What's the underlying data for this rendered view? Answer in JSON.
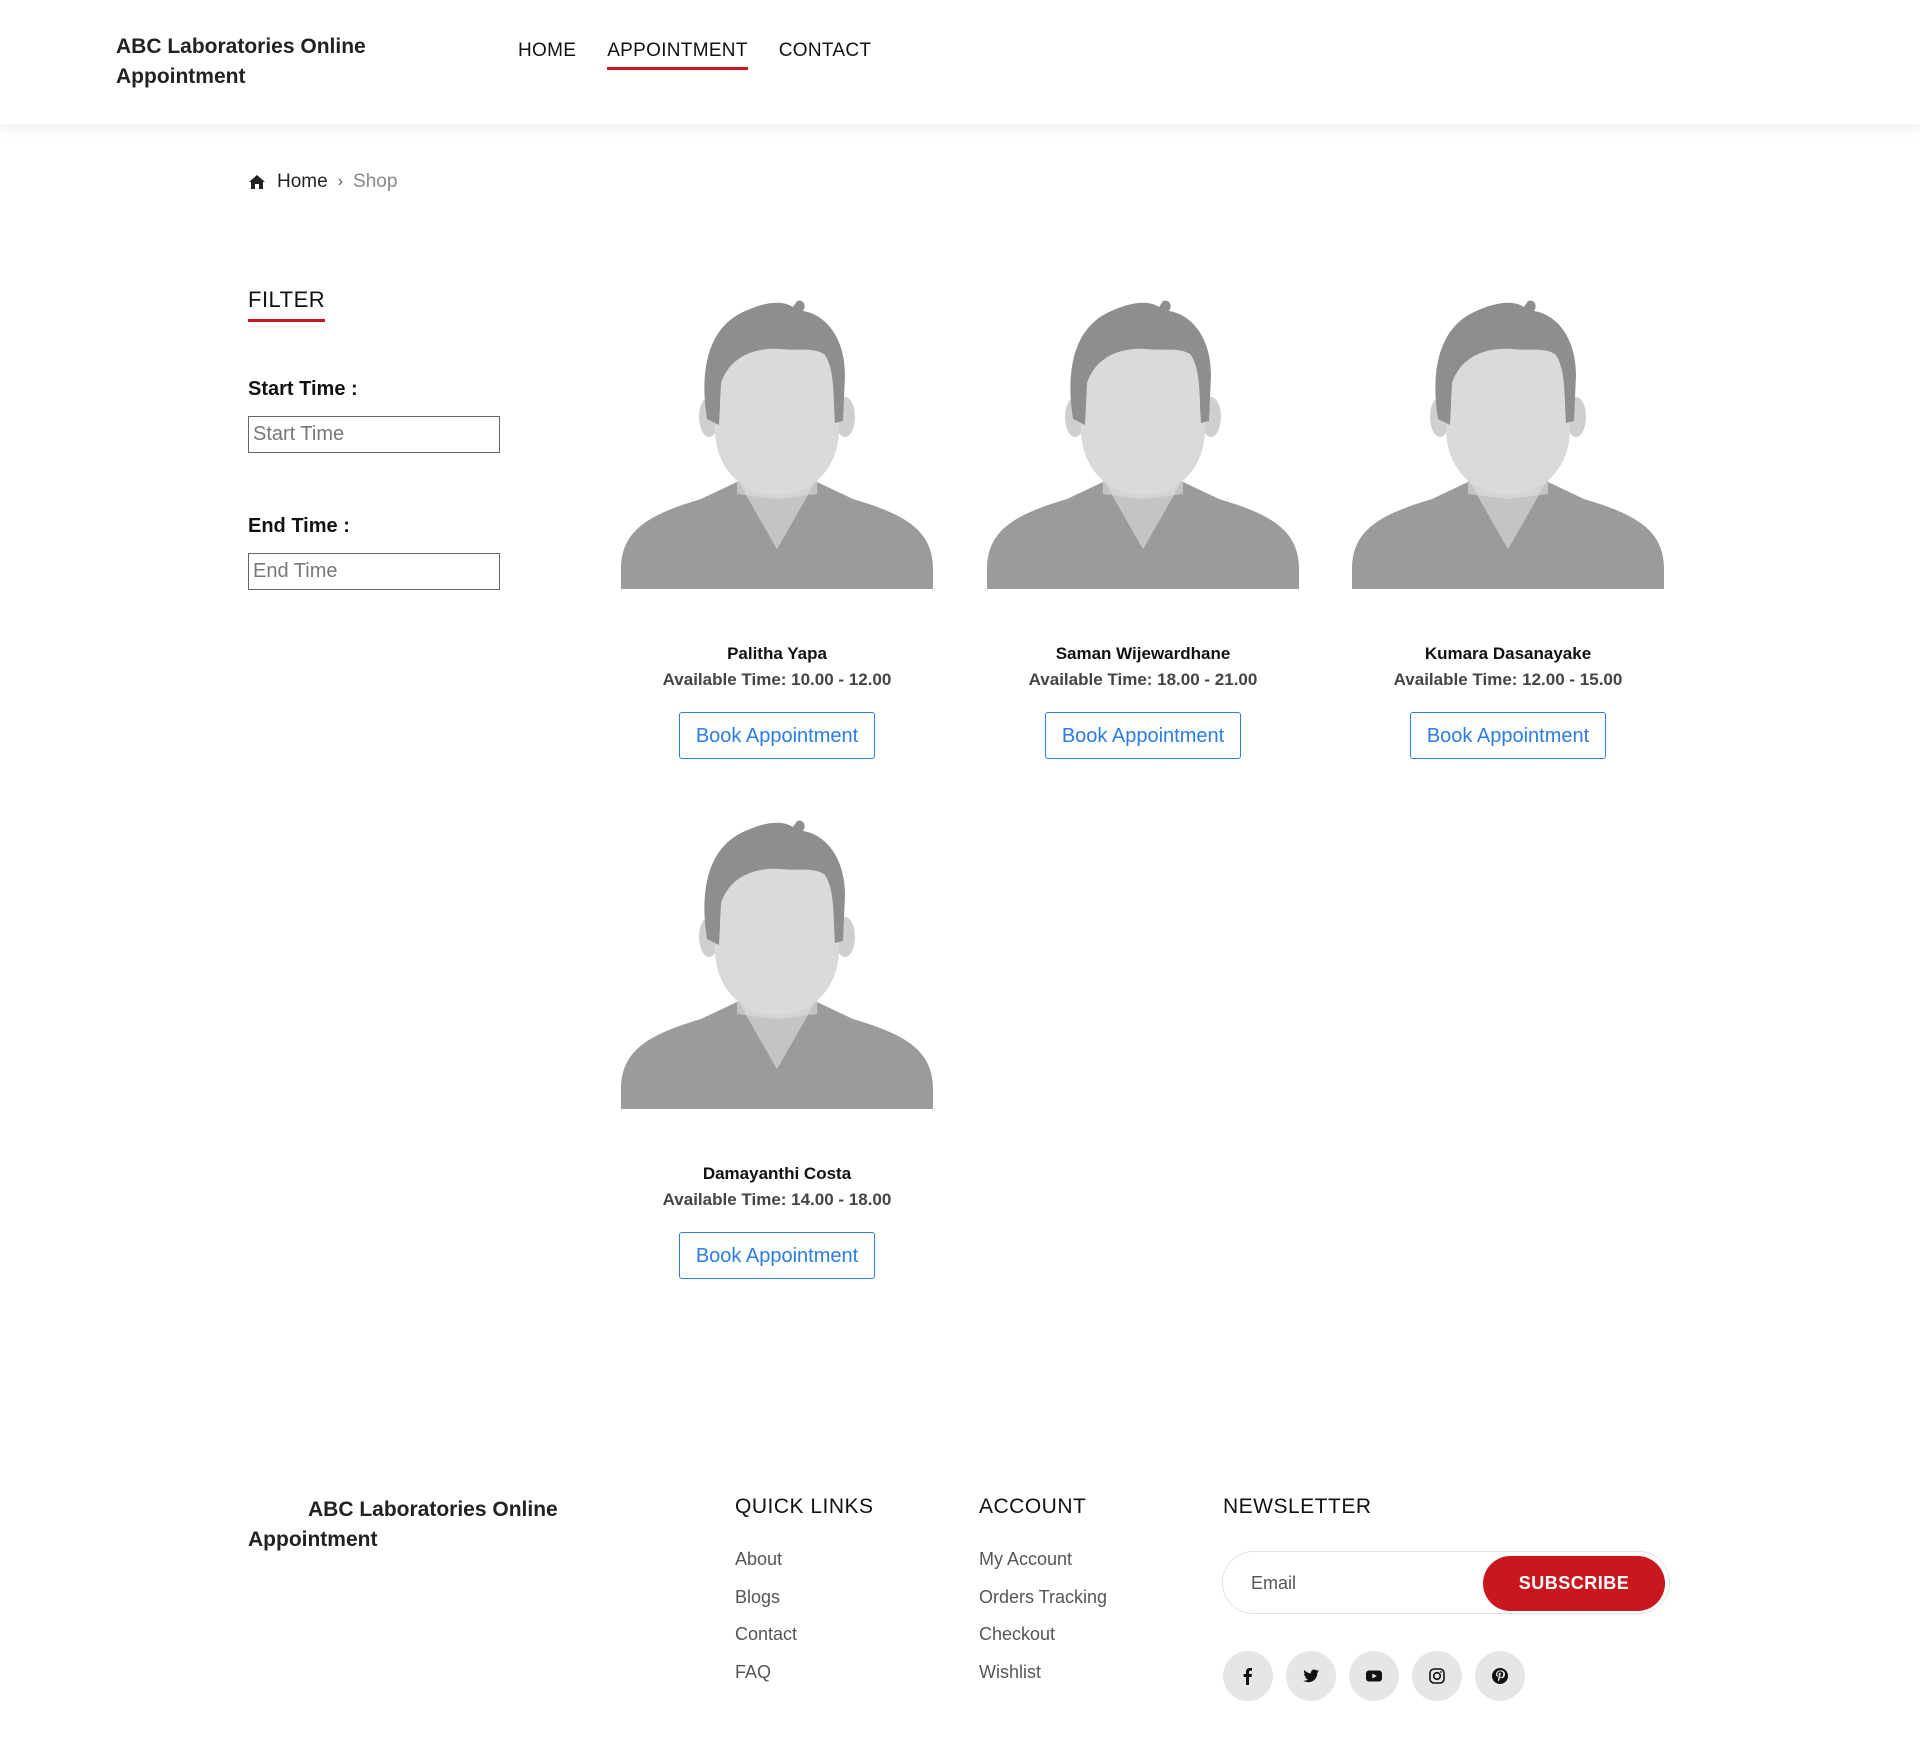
{
  "header": {
    "brand": "ABC Laboratories Online Appointment",
    "nav": [
      {
        "label": "HOME",
        "active": false
      },
      {
        "label": "APPOINTMENT",
        "active": true
      },
      {
        "label": "CONTACT",
        "active": false
      }
    ]
  },
  "breadcrumb": {
    "home": "Home",
    "current": "Shop"
  },
  "filter": {
    "title": "FILTER",
    "start_label": "Start Time :",
    "start_placeholder": "Start Time",
    "end_label": "End Time :",
    "end_placeholder": "End Time"
  },
  "doctors": [
    {
      "name": "Palitha Yapa",
      "time": "Available Time: 10.00 - 12.00",
      "button": "Book Appointment"
    },
    {
      "name": "Saman Wijewardhane",
      "time": "Available Time: 18.00 - 21.00",
      "button": "Book Appointment"
    },
    {
      "name": "Kumara Dasanayake",
      "time": "Available Time: 12.00 - 15.00",
      "button": "Book Appointment"
    },
    {
      "name": "Damayanthi Costa",
      "time": "Available Time: 14.00 - 18.00",
      "button": "Book Appointment"
    }
  ],
  "footer": {
    "brand": "ABC Laboratories Online Appointment",
    "quick_links": {
      "title": "QUICK LINKS",
      "items": [
        "About",
        "Blogs",
        "Contact",
        "FAQ"
      ]
    },
    "account": {
      "title": "ACCOUNT",
      "items": [
        "My Account",
        "Orders Tracking",
        "Checkout",
        "Wishlist"
      ]
    },
    "newsletter": {
      "title": "NEWSLETTER",
      "email_placeholder": "Email",
      "subscribe_label": "SUBSCRIBE"
    },
    "socials": [
      "facebook-icon",
      "twitter-icon",
      "youtube-icon",
      "instagram-icon",
      "pinterest-icon"
    ]
  },
  "colors": {
    "accent_red": "#c9171e",
    "button_blue": "#2b7de1",
    "avatar_gray": "#9b9b9b"
  }
}
